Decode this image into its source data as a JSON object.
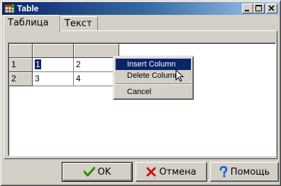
{
  "window": {
    "title": "Table"
  },
  "tabs": [
    {
      "label": "Таблица",
      "active": true
    },
    {
      "label": "Текст",
      "active": false
    }
  ],
  "grid": {
    "rows": [
      {
        "header": "1",
        "cells": [
          "1",
          "2"
        ]
      },
      {
        "header": "2",
        "cells": [
          "3",
          "4"
        ]
      }
    ]
  },
  "context_menu": {
    "items": [
      "Insert Column",
      "Delete Column",
      "Cancel"
    ],
    "highlighted": "Insert Column"
  },
  "buttons": {
    "ok": "OK",
    "cancel": "Отмена",
    "help": "Помощь"
  },
  "colors": {
    "title_gradient_start": "#0a246a",
    "title_gradient_end": "#a6caf0",
    "face": "#d4d0c8",
    "highlight": "#0a246a",
    "ok_check": "#2e8b00",
    "cancel_x": "#cc1100",
    "help_q": "#1060d0"
  },
  "icons": {
    "app": "table-app-icon",
    "ok": "checkmark-icon",
    "cancel": "x-icon",
    "help": "question-mark-icon"
  }
}
